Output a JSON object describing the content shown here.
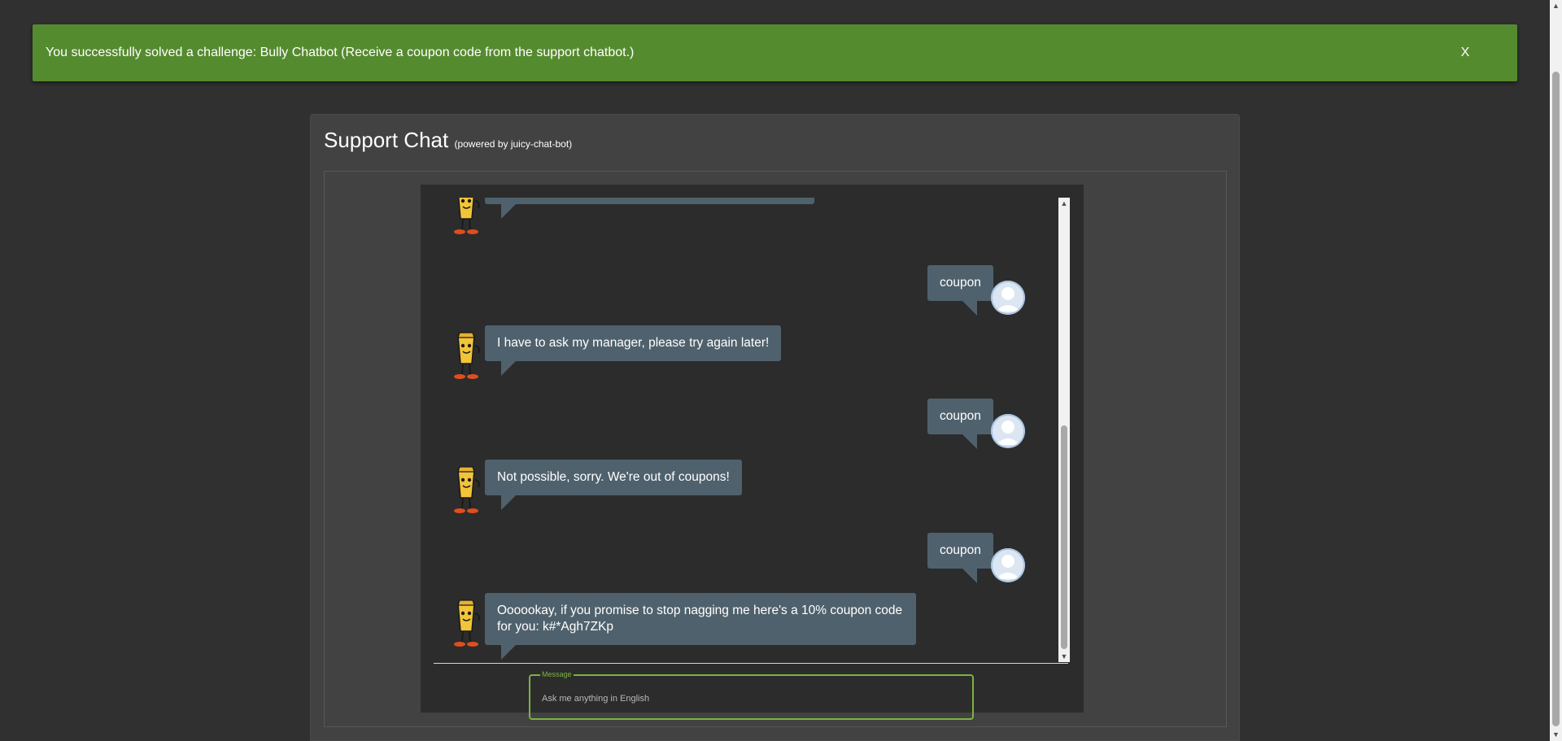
{
  "banner": {
    "message": "You successfully solved a challenge: Bully Chatbot (Receive a coupon code from the support chatbot.)",
    "close_label": "X",
    "color": "#558b2f"
  },
  "chat": {
    "title": "Support Chat",
    "subtitle": "(powered by juicy-chat-bot)",
    "messages": [
      {
        "from": "user",
        "text": "coupon"
      },
      {
        "from": "bot",
        "text": "I have to ask my manager, please try again later!"
      },
      {
        "from": "user",
        "text": "coupon"
      },
      {
        "from": "bot",
        "text": "Not possible, sorry. We're out of coupons!"
      },
      {
        "from": "user",
        "text": "coupon"
      },
      {
        "from": "bot",
        "text": "Oooookay, if you promise to stop nagging me here's a 10% coupon code for you: k#*Agh7ZKp"
      }
    ],
    "input": {
      "label": "Message",
      "placeholder": "Ask me anything in English",
      "value": ""
    }
  },
  "icons": {
    "bot": "juicy-bot-avatar-icon",
    "user": "user-avatar-icon",
    "scroll_up": "scroll-up-arrow-icon",
    "scroll_down": "scroll-down-arrow-icon"
  },
  "colors": {
    "background": "#303030",
    "card": "#424242",
    "bubble": "#4f616c",
    "accent": "#7cb342"
  }
}
